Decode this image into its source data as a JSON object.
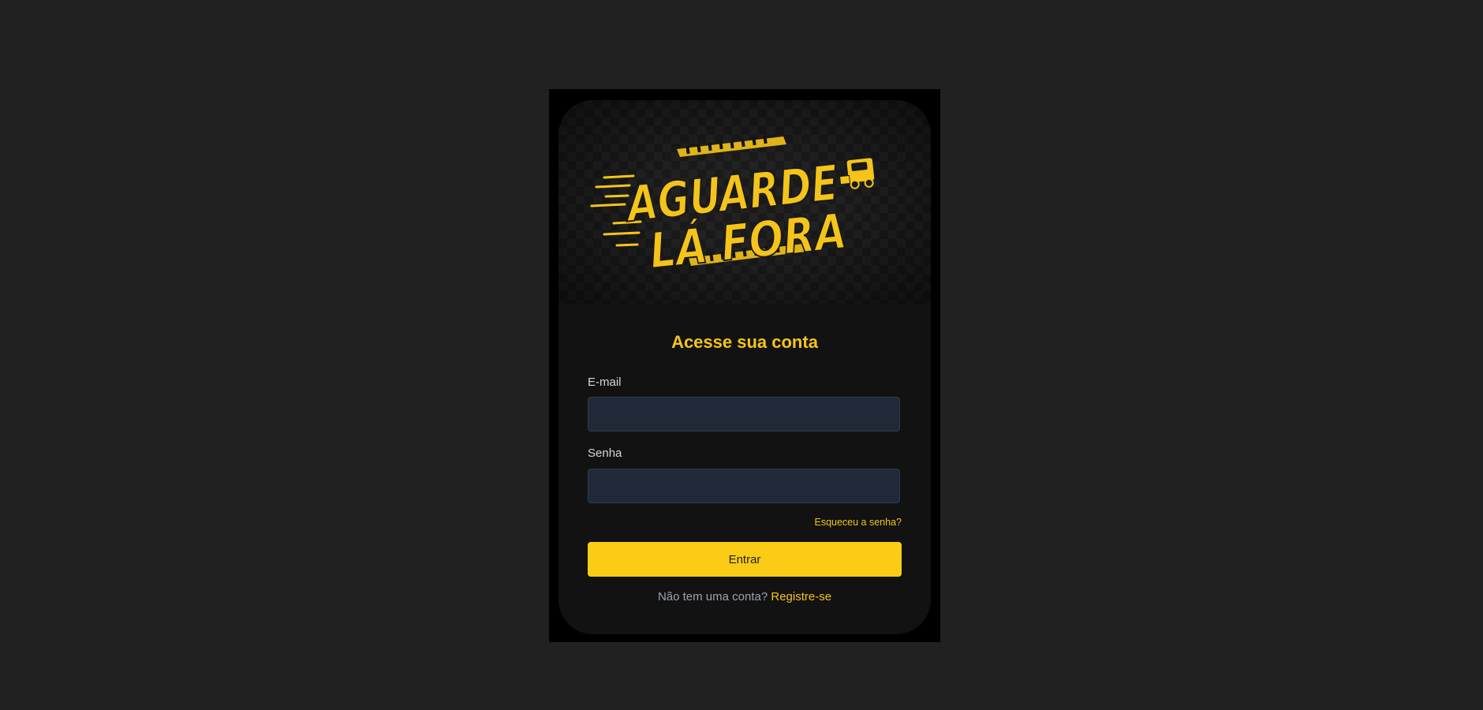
{
  "banner": {
    "logo_line1": "AGUARDE",
    "logo_line2": "LÁ FORA",
    "logo_color": "#f5c41a",
    "truck_icon": "truck-icon"
  },
  "form": {
    "heading": "Acesse sua conta",
    "email_label": "E-mail",
    "email_value": "",
    "email_placeholder": "",
    "password_label": "Senha",
    "password_value": "",
    "password_placeholder": "",
    "forgot_label": "Esqueceu a senha?",
    "submit_label": "Entrar",
    "signup_prompt": "Não tem uma conta?",
    "signup_link": "Registre-se"
  },
  "colors": {
    "page_background": "#212121",
    "card_background": "#121212",
    "accent": "#facc15",
    "input_background": "#1f2937"
  }
}
